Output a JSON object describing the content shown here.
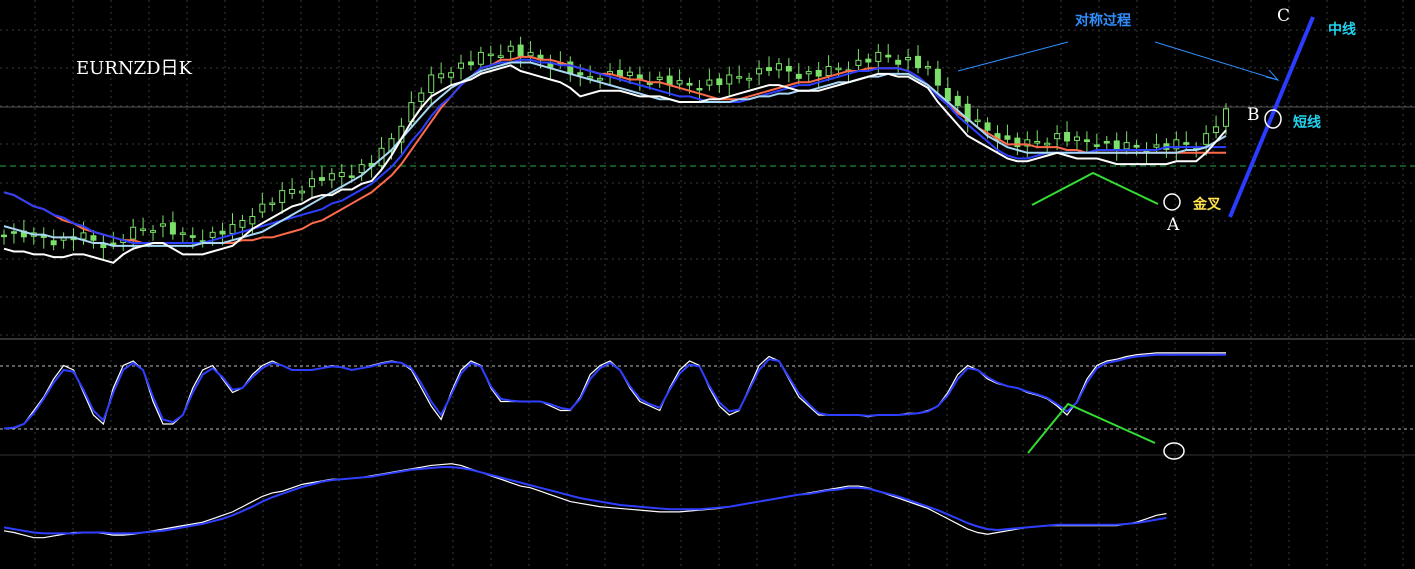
{
  "chart_title": "EURNZD日K",
  "annotations": {
    "symmetry": "对称过程",
    "point_a": "A",
    "point_b": "B",
    "point_c": "C",
    "golden_cross": "金叉",
    "mid_line": "中线",
    "short_line": "短线"
  },
  "colors": {
    "background": "#000000",
    "grid": "#3a3a3a",
    "bull_candle": "#7be06a",
    "bear_candle": "#7be06a",
    "ma_fast": "#ffffff",
    "ma_mid": "#ff6a4a",
    "ma_slow": "#a9d8f5",
    "ma_blue": "#2f3fff",
    "osc_fast": "#ffffff",
    "osc_slow": "#2f3fff",
    "trend_line": "#2b3bff",
    "pattern": "#33dd33",
    "annotation_blue": "#2f8fff",
    "golden": "#ffe14d",
    "cyan": "#22d3ee"
  },
  "chart_data": {
    "type": "line",
    "title": "EURNZD日K",
    "grid": true,
    "price_panel": {
      "x": [
        0,
        10,
        20,
        30,
        40,
        50,
        60,
        70,
        80,
        90,
        100,
        110,
        120,
        130,
        140,
        150,
        160,
        170,
        180,
        190,
        200,
        210,
        220,
        230,
        240,
        250,
        260,
        270,
        280,
        290,
        300,
        310,
        320,
        330,
        340,
        350,
        360,
        370,
        380,
        390,
        400,
        410,
        420,
        430,
        440,
        450,
        460,
        470,
        480,
        490,
        500,
        510,
        520,
        530,
        540,
        550,
        560,
        570,
        580,
        590,
        600,
        610,
        620,
        630,
        640,
        650,
        660,
        670,
        680,
        690,
        700,
        710,
        720,
        730,
        740,
        750,
        760,
        770,
        780,
        790,
        800,
        810,
        820,
        830,
        840,
        850,
        860,
        870,
        880,
        890,
        900,
        910,
        920,
        930,
        940,
        950,
        960,
        970,
        980,
        990,
        1000,
        1010,
        1020,
        1030,
        1040,
        1050,
        1060,
        1070,
        1080,
        1090,
        1100,
        1110,
        1120,
        1130,
        1140,
        1150,
        1160,
        1170,
        1180,
        1190,
        1200,
        1210,
        1220,
        1230
      ],
      "ylim": [
        0,
        100
      ],
      "series": [
        {
          "values": [
            32,
            31,
            31,
            30,
            30,
            29,
            29,
            30,
            30,
            29,
            28,
            27,
            30,
            32,
            33,
            34,
            34,
            32,
            30,
            30,
            30,
            31,
            32,
            33,
            36,
            39,
            41,
            43,
            45,
            47,
            48,
            50,
            51,
            51,
            53,
            53,
            55,
            56,
            60,
            65,
            71,
            77,
            82,
            86,
            88,
            90,
            91,
            92,
            94,
            95,
            96,
            97,
            95,
            94,
            93,
            92,
            91,
            89,
            86,
            87,
            88,
            88,
            88,
            87,
            86,
            86,
            86,
            85,
            84,
            84,
            84,
            85,
            85,
            86,
            87,
            88,
            89,
            90,
            90,
            89,
            88,
            88,
            88,
            89,
            90,
            91,
            92,
            93,
            94,
            94,
            93,
            93,
            91,
            89,
            84,
            80,
            76,
            72,
            70,
            68,
            66,
            64,
            63,
            63,
            64,
            65,
            66,
            65,
            64,
            64,
            64,
            63,
            62,
            62,
            62,
            62,
            62,
            62,
            63,
            63,
            63,
            66,
            70,
            74
          ]
        },
        {
          "values": [
            46,
            45,
            43,
            41,
            40,
            38,
            36,
            35,
            33,
            32,
            31,
            30,
            29,
            29,
            28,
            28,
            28,
            28,
            28,
            28,
            28,
            28,
            28,
            28,
            29,
            29,
            30,
            30,
            31,
            32,
            33,
            35,
            36,
            38,
            40,
            42,
            44,
            46,
            49,
            52,
            56,
            61,
            66,
            71,
            76,
            80,
            84,
            87,
            90,
            91,
            93,
            93,
            94,
            94,
            93,
            93,
            92,
            91,
            90,
            89,
            88,
            88,
            87,
            86,
            86,
            85,
            85,
            84,
            83,
            82,
            81,
            80,
            79,
            79,
            79,
            80,
            81,
            82,
            83,
            84,
            85,
            85,
            86,
            87,
            88,
            89,
            89,
            90,
            90,
            90,
            90,
            89,
            87,
            84,
            80,
            77,
            74,
            72,
            69,
            67,
            65,
            63,
            63,
            63,
            62,
            62,
            62,
            61,
            61,
            60,
            60,
            60,
            60,
            60,
            60,
            60,
            60,
            60,
            60,
            60,
            60,
            60,
            60,
            60
          ]
        },
        {
          "values": [
            46,
            45,
            43,
            41,
            40,
            38,
            37,
            35,
            34,
            32,
            31,
            30,
            29,
            28,
            28,
            28,
            28,
            28,
            28,
            28,
            28,
            29,
            30,
            31,
            32,
            33,
            34,
            35,
            36,
            37,
            38,
            39,
            40,
            42,
            43,
            45,
            47,
            49,
            52,
            55,
            59,
            64,
            68,
            73,
            77,
            80,
            84,
            87,
            90,
            91,
            92,
            92,
            93,
            93,
            92,
            92,
            91,
            91,
            90,
            89,
            88,
            87,
            86,
            85,
            84,
            83,
            82,
            81,
            80,
            80,
            79,
            78,
            78,
            78,
            78,
            79,
            80,
            81,
            82,
            83,
            84,
            84,
            85,
            86,
            87,
            88,
            89,
            89,
            90,
            90,
            90,
            89,
            87,
            84,
            80,
            77,
            73,
            70,
            67,
            64,
            61,
            59,
            58,
            58,
            59,
            60,
            60,
            60,
            60,
            60,
            61,
            61,
            61,
            61,
            61,
            61,
            61,
            62,
            62,
            62,
            62,
            62,
            62,
            62
          ]
        },
        {
          "values": [
            34,
            33,
            32,
            31,
            31,
            30,
            30,
            30,
            29,
            28,
            28,
            27,
            27,
            27,
            27,
            27,
            27,
            27,
            27,
            27,
            28,
            28,
            28,
            29,
            30,
            31,
            32,
            34,
            36,
            38,
            40,
            42,
            44,
            46,
            48,
            50,
            52,
            55,
            58,
            61,
            65,
            69,
            73,
            77,
            80,
            83,
            85,
            87,
            89,
            90,
            91,
            92,
            92,
            92,
            91,
            90,
            89,
            88,
            87,
            86,
            85,
            84,
            83,
            82,
            81,
            80,
            79,
            79,
            78,
            78,
            78,
            78,
            78,
            78,
            79,
            79,
            80,
            80,
            81,
            81,
            82,
            82,
            83,
            84,
            85,
            85,
            86,
            87,
            87,
            88,
            88,
            88,
            86,
            84,
            81,
            78,
            75,
            72,
            69,
            66,
            64,
            62,
            61,
            60,
            60,
            60,
            60,
            60,
            60,
            60,
            60,
            60,
            60,
            60,
            60,
            60,
            60,
            60,
            60,
            61,
            61,
            62,
            64,
            66
          ]
        }
      ]
    },
    "oscillator_panel": {
      "ylim": [
        0,
        100
      ],
      "series": [
        {
          "values": [
            15,
            15,
            20,
            35,
            50,
            70,
            85,
            80,
            55,
            30,
            20,
            60,
            85,
            90,
            80,
            45,
            20,
            20,
            30,
            60,
            80,
            85,
            70,
            55,
            60,
            75,
            85,
            90,
            85,
            80,
            80,
            80,
            82,
            85,
            83,
            80,
            82,
            85,
            88,
            90,
            88,
            80,
            60,
            40,
            25,
            55,
            80,
            90,
            85,
            60,
            45,
            45,
            45,
            45,
            45,
            40,
            35,
            35,
            50,
            75,
            85,
            90,
            80,
            60,
            45,
            40,
            35,
            60,
            80,
            90,
            85,
            60,
            40,
            30,
            35,
            60,
            85,
            95,
            90,
            70,
            50,
            40,
            30,
            30,
            30,
            30,
            30,
            28,
            30,
            30,
            30,
            32,
            32,
            35,
            40,
            55,
            75,
            85,
            80,
            70,
            65,
            62,
            60,
            55,
            52,
            48,
            40,
            30,
            45,
            70,
            85,
            90,
            92,
            95,
            97,
            98,
            99,
            99,
            99,
            99,
            99,
            99,
            99,
            99
          ]
        },
        {
          "values": [
            15,
            16,
            20,
            32,
            48,
            66,
            80,
            78,
            58,
            35,
            24,
            55,
            80,
            88,
            80,
            50,
            25,
            22,
            30,
            55,
            75,
            82,
            72,
            58,
            60,
            72,
            82,
            88,
            85,
            80,
            80,
            80,
            82,
            84,
            83,
            80,
            82,
            84,
            87,
            89,
            88,
            82,
            65,
            45,
            30,
            52,
            76,
            88,
            84,
            62,
            48,
            46,
            45,
            45,
            45,
            42,
            38,
            36,
            48,
            70,
            82,
            88,
            80,
            62,
            48,
            42,
            38,
            58,
            76,
            86,
            84,
            62,
            44,
            34,
            36,
            58,
            80,
            92,
            90,
            72,
            54,
            42,
            32,
            30,
            30,
            30,
            30,
            29,
            30,
            30,
            30,
            31,
            32,
            34,
            40,
            52,
            70,
            82,
            80,
            72,
            66,
            62,
            60,
            56,
            53,
            49,
            42,
            34,
            44,
            66,
            82,
            88,
            90,
            93,
            95,
            96,
            97,
            97,
            97,
            97,
            97,
            97,
            97,
            97
          ]
        }
      ]
    },
    "momentum_panel": {
      "ylim": [
        0,
        100
      ],
      "series": [
        {
          "values": [
            20,
            18,
            15,
            12,
            12,
            14,
            16,
            18,
            18,
            18,
            17,
            15,
            15,
            16,
            18,
            20,
            22,
            24,
            26,
            28,
            30,
            34,
            38,
            42,
            48,
            54,
            60,
            64,
            66,
            70,
            74,
            76,
            78,
            80,
            80,
            81,
            82,
            84,
            86,
            88,
            90,
            92,
            94,
            96,
            97,
            98,
            96,
            92,
            88,
            84,
            80,
            76,
            72,
            70,
            66,
            62,
            58,
            54,
            52,
            50,
            48,
            47,
            46,
            45,
            44,
            43,
            42,
            42,
            42,
            43,
            44,
            45,
            46,
            48,
            50,
            52,
            54,
            56,
            58,
            60,
            62,
            64,
            66,
            68,
            70,
            72,
            72,
            70,
            66,
            62,
            58,
            54,
            50,
            46,
            40,
            34,
            28,
            22,
            18,
            16,
            18,
            20,
            22,
            24,
            25,
            26,
            26,
            26,
            26,
            26,
            26,
            26,
            26,
            28,
            30,
            34,
            38,
            40
          ]
        },
        {
          "values": [
            24,
            22,
            20,
            18,
            17,
            17,
            17,
            17,
            18,
            18,
            18,
            17,
            17,
            17,
            18,
            19,
            20,
            22,
            24,
            26,
            28,
            31,
            34,
            38,
            43,
            48,
            54,
            59,
            63,
            67,
            71,
            74,
            77,
            79,
            80,
            81,
            82,
            83,
            85,
            87,
            89,
            91,
            92,
            93,
            94,
            94,
            93,
            91,
            88,
            85,
            82,
            79,
            76,
            73,
            70,
            67,
            64,
            61,
            58,
            56,
            54,
            52,
            50,
            49,
            48,
            47,
            46,
            45,
            45,
            45,
            45,
            46,
            47,
            48,
            50,
            52,
            54,
            56,
            58,
            60,
            62,
            63,
            65,
            67,
            68,
            70,
            70,
            69,
            66,
            63,
            60,
            56,
            52,
            48,
            44,
            39,
            34,
            29,
            25,
            22,
            21,
            22,
            23,
            24,
            25,
            26,
            27,
            27,
            27,
            27,
            27,
            27,
            27,
            28,
            29,
            31,
            33,
            35
          ]
        }
      ]
    }
  }
}
